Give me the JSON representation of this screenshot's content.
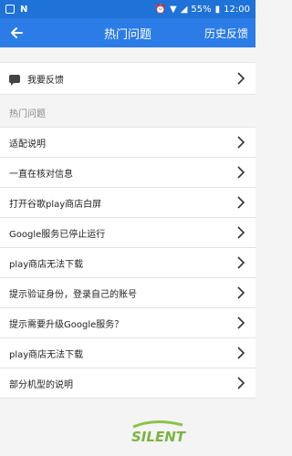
{
  "status_bar": {
    "battery": "55%",
    "time": "12:00"
  },
  "app_bar": {
    "title": "热门问题",
    "right_action": "历史反馈"
  },
  "feedback": {
    "label": "我要反馈"
  },
  "section": {
    "title": "热门问题"
  },
  "list": {
    "items": [
      "适配说明",
      "一直在核对信息",
      "打开谷歌play商店白屏",
      "Google服务已停止运行",
      "play商店无法下载",
      "提示验证身份，登录自己的账号",
      "提示需要升级Google服务？",
      "play商店无法下载",
      "部分机型的说明"
    ]
  },
  "watermark": {
    "text": "SILENT"
  },
  "colors": {
    "status_bar": "#1e72d8",
    "app_bar": "#2b7ce6"
  }
}
